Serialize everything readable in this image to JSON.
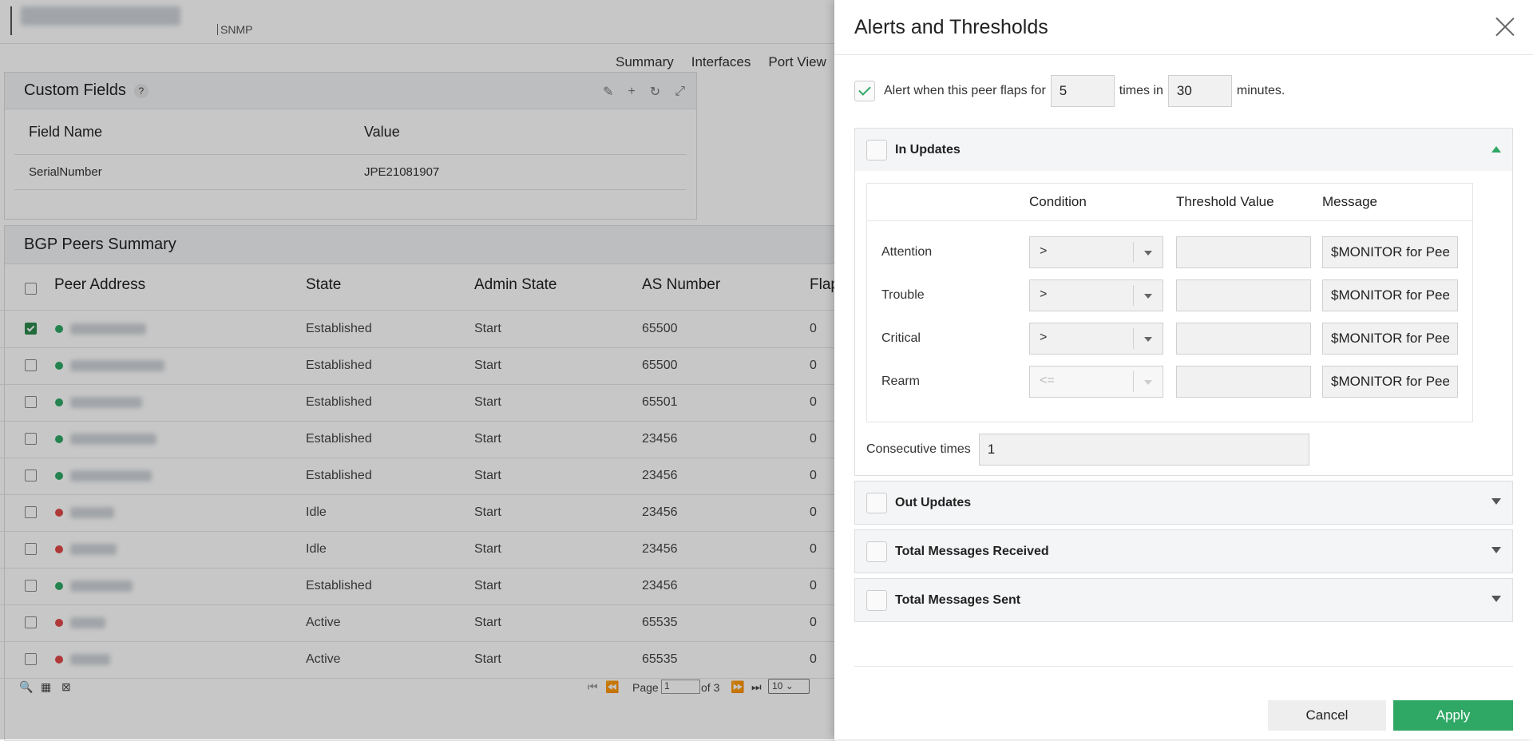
{
  "header": {
    "protocol_label": "SNMP"
  },
  "tabs": [
    {
      "label": "Summary",
      "active": true
    },
    {
      "label": "Interfaces"
    },
    {
      "label": "Port View"
    }
  ],
  "custom_fields": {
    "title": "Custom Fields",
    "help": "?",
    "columns": [
      "Field Name",
      "Value"
    ],
    "rows": [
      {
        "name": "SerialNumber",
        "value": "JPE21081907"
      }
    ]
  },
  "bgp": {
    "title": "BGP Peers Summary",
    "columns": [
      "Peer Address",
      "State",
      "Admin State",
      "AS Number",
      "Flap"
    ],
    "rows": [
      {
        "state": "Established",
        "admin": "Start",
        "as": "65500",
        "flap": "0",
        "status": "up",
        "checked": true
      },
      {
        "state": "Established",
        "admin": "Start",
        "as": "65500",
        "flap": "0",
        "status": "up",
        "checked": false
      },
      {
        "state": "Established",
        "admin": "Start",
        "as": "65501",
        "flap": "0",
        "status": "up",
        "checked": false
      },
      {
        "state": "Established",
        "admin": "Start",
        "as": "23456",
        "flap": "0",
        "status": "up",
        "checked": false
      },
      {
        "state": "Established",
        "admin": "Start",
        "as": "23456",
        "flap": "0",
        "status": "up",
        "checked": false
      },
      {
        "state": "Idle",
        "admin": "Start",
        "as": "23456",
        "flap": "0",
        "status": "down",
        "checked": false
      },
      {
        "state": "Idle",
        "admin": "Start",
        "as": "23456",
        "flap": "0",
        "status": "down",
        "checked": false
      },
      {
        "state": "Established",
        "admin": "Start",
        "as": "23456",
        "flap": "0",
        "status": "up",
        "checked": false
      },
      {
        "state": "Active",
        "admin": "Start",
        "as": "65535",
        "flap": "0",
        "status": "down",
        "checked": false
      },
      {
        "state": "Active",
        "admin": "Start",
        "as": "65535",
        "flap": "0",
        "status": "down",
        "checked": false
      }
    ],
    "pager": {
      "page_label": "Page",
      "page": "1",
      "of_label": "of 3",
      "page_size": "10"
    }
  },
  "colors": {
    "accent": "#2fa865",
    "up": "#2fa865",
    "down": "#e04848"
  },
  "dialog": {
    "title": "Alerts and Thresholds",
    "flap": {
      "label_pre": "Alert when this peer flaps for",
      "count": "5",
      "label_mid": "times in",
      "minutes": "30",
      "label_post": "minutes.",
      "checked": true
    },
    "sections": [
      {
        "label": "In Updates",
        "expanded": true,
        "columns": [
          "Condition",
          "Threshold Value",
          "Message"
        ],
        "rows": [
          {
            "label": "Attention",
            "condition": ">",
            "threshold": "",
            "message": "$MONITOR for Pee",
            "disabled": false
          },
          {
            "label": "Trouble",
            "condition": ">",
            "threshold": "",
            "message": "$MONITOR for Pee",
            "disabled": false
          },
          {
            "label": "Critical",
            "condition": ">",
            "threshold": "",
            "message": "$MONITOR for Pee",
            "disabled": false
          },
          {
            "label": "Rearm",
            "condition": "<=",
            "threshold": "",
            "message": "$MONITOR for Pee",
            "disabled": true
          }
        ],
        "consecutive_label": "Consecutive times",
        "consecutive_value": "1"
      },
      {
        "label": "Out Updates",
        "expanded": false
      },
      {
        "label": "Total Messages Received",
        "expanded": false
      },
      {
        "label": "Total Messages Sent",
        "expanded": false
      }
    ],
    "cancel_label": "Cancel",
    "apply_label": "Apply"
  }
}
